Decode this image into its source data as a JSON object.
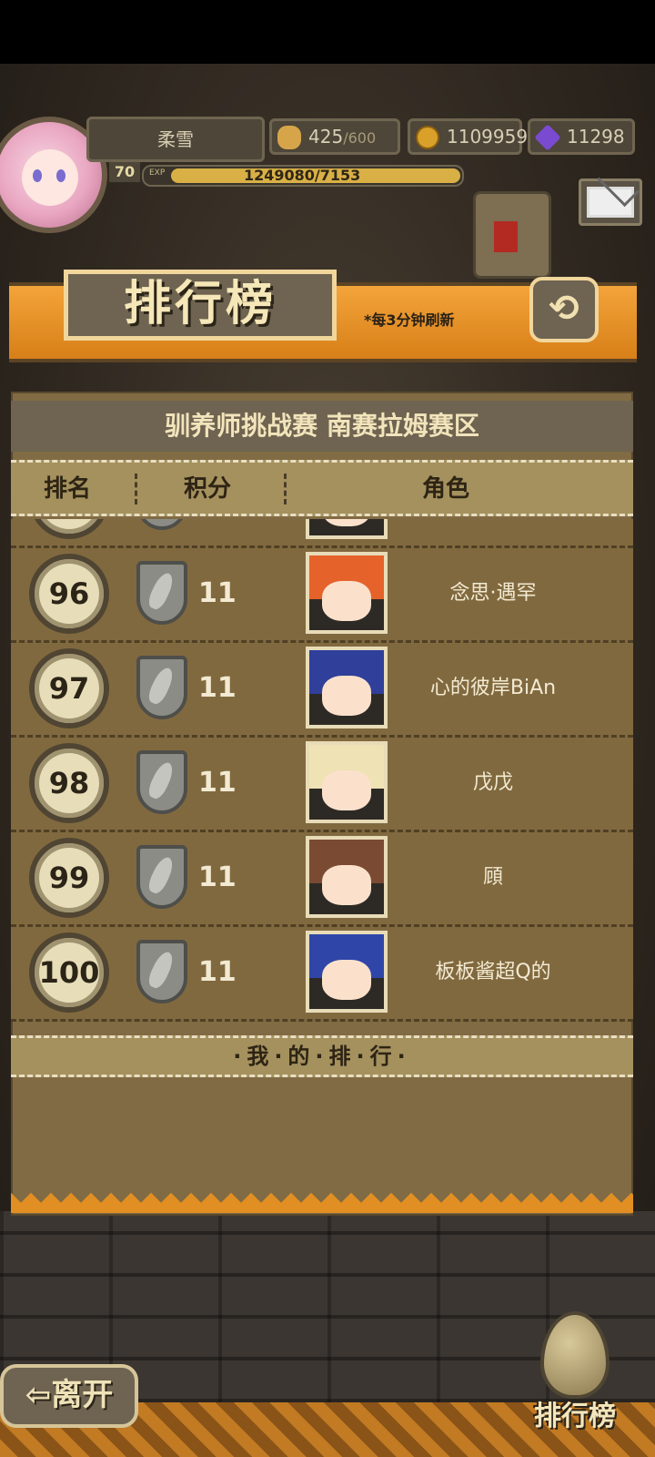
{
  "player": {
    "name": "柔雪",
    "level": "70",
    "exp_tag": "EXP",
    "exp_text": "1249080/7153",
    "stamina": "425",
    "stamina_max": "/600",
    "gold": "1109959",
    "gems": "11298"
  },
  "banner": {
    "title": "排行榜",
    "subtitle": "*每3分钟刷新",
    "back_icon": "⟲"
  },
  "board": {
    "title": "驯养师挑战赛 南赛拉姆赛区",
    "headers": {
      "rank": "排名",
      "score": "积分",
      "role": "角色"
    },
    "rows": [
      {
        "rank": "96",
        "score": "11",
        "name": "念思·遇罕",
        "hair": "#e5622a"
      },
      {
        "rank": "97",
        "score": "11",
        "name": "心的彼岸BiAn",
        "hair": "#2f3f9a"
      },
      {
        "rank": "98",
        "score": "11",
        "name": "戊戊",
        "hair": "#efe2b4"
      },
      {
        "rank": "99",
        "score": "11",
        "name": "頋",
        "hair": "#7a4a32"
      },
      {
        "rank": "100",
        "score": "11",
        "name": "板板酱超Q的",
        "hair": "#2f46a8"
      }
    ],
    "my_rank_label": "·我·的·排·行·"
  },
  "buttons": {
    "leave": "⇦离开",
    "ranking": "排行榜"
  },
  "colors": {
    "banner_orange": "#e8922a",
    "board_brown": "#816b44"
  }
}
